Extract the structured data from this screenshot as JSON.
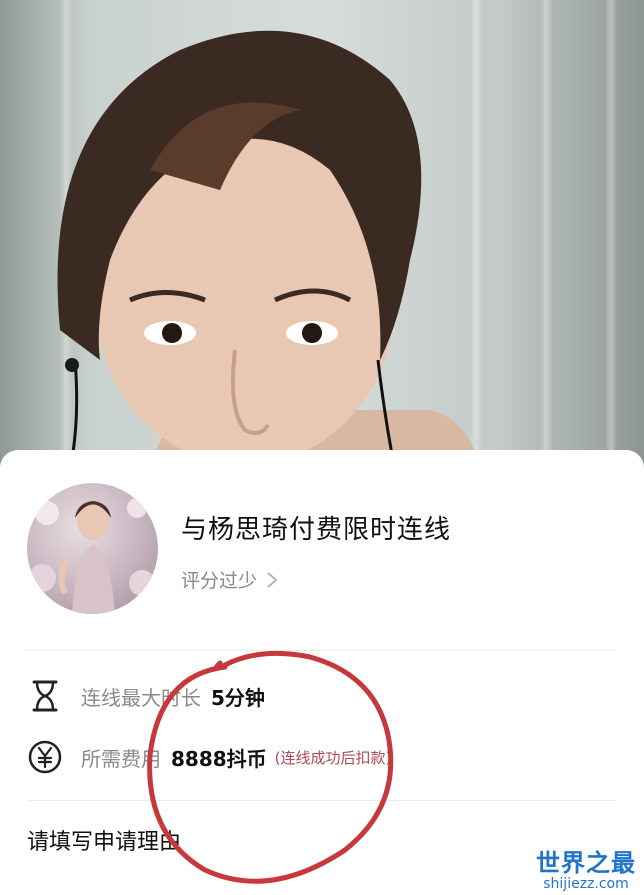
{
  "live_video": {
    "alt": "host video"
  },
  "sheet": {
    "title": "与杨思琦付费限时连线",
    "rating_text": "评分过少",
    "max_duration": {
      "label": "连线最大时长",
      "value": "5分钟",
      "icon": "hourglass-icon"
    },
    "fee": {
      "label": "所需费用",
      "value": "8888抖币",
      "note": "(连线成功后扣款)",
      "icon": "yen-circle-icon"
    },
    "reason_label": "请填写申请理由"
  },
  "watermark": {
    "title": "世界之最",
    "subtitle": "shijiezz.com"
  },
  "colors": {
    "annotation_red": "#c6383b",
    "note_red": "#b04a57",
    "watermark_blue": "#1f74c9"
  }
}
